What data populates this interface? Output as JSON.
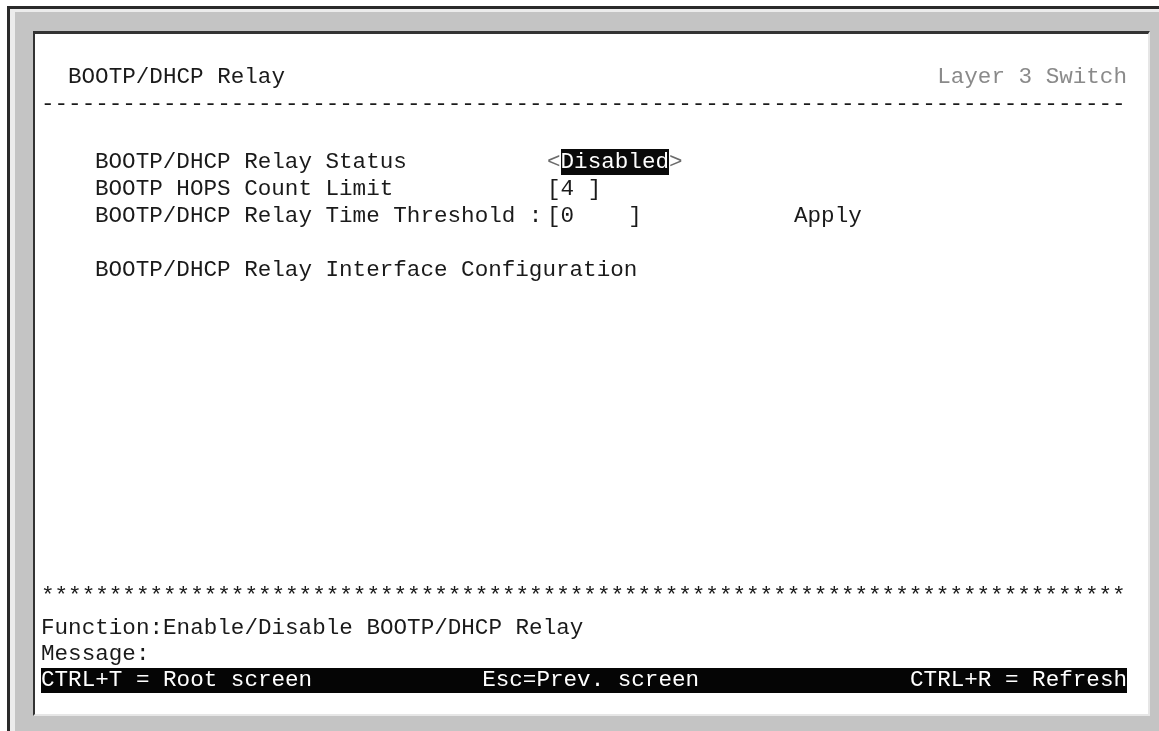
{
  "header": {
    "title": "BOOTP/DHCP Relay",
    "device": "Layer 3 Switch",
    "rule": "--------------------------------------------------------------------------------"
  },
  "settings": [
    {
      "kind": "selector",
      "label": "BOOTP/DHCP Relay Status",
      "prefix": "<",
      "value": "Disabled",
      "suffix": ">",
      "focused": true
    },
    {
      "kind": "input",
      "label": "BOOTP HOPS Count Limit",
      "value": "[4 ]"
    },
    {
      "kind": "input",
      "label": "BOOTP/DHCP Relay Time Threshold :",
      "value": "[0    ]",
      "action": "Apply"
    }
  ],
  "links": [
    "BOOTP/DHCP Relay Interface Configuration"
  ],
  "footer": {
    "rule": "********************************************************************************",
    "function": "Function:Enable/Disable BOOTP/DHCP Relay",
    "message": "Message:",
    "shortcuts": [
      "CTRL+T = Root screen",
      "Esc=Prev. screen",
      "CTRL+R = Refresh"
    ]
  }
}
